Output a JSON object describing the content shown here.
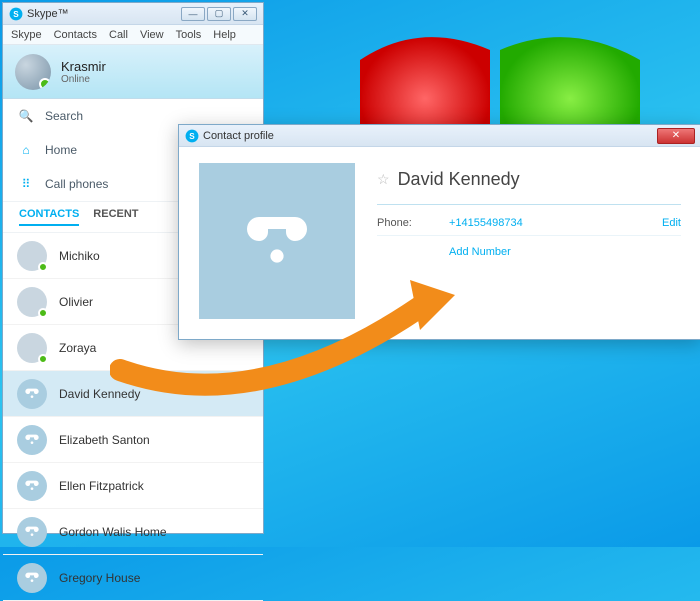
{
  "window": {
    "title": "Skype™",
    "menu": {
      "skype": "Skype",
      "contacts": "Contacts",
      "call": "Call",
      "view": "View",
      "tools": "Tools",
      "help": "Help"
    }
  },
  "user": {
    "name": "Krasmir",
    "status": "Online"
  },
  "nav": {
    "search": "Search",
    "home": "Home",
    "callphones": "Call phones"
  },
  "tabs": {
    "contacts": "CONTACTS",
    "recent": "RECENT"
  },
  "contacts": [
    {
      "name": "Michiko",
      "type": "person",
      "online": true
    },
    {
      "name": "Olivier",
      "type": "person",
      "online": true
    },
    {
      "name": "Zoraya",
      "type": "person",
      "online": true
    },
    {
      "name": "David Kennedy",
      "type": "phone",
      "online": false
    },
    {
      "name": "Elizabeth Santon",
      "type": "phone",
      "online": false
    },
    {
      "name": "Ellen Fitzpatrick",
      "type": "phone",
      "online": false
    },
    {
      "name": "Gordon Walis Home",
      "type": "phone",
      "online": false
    },
    {
      "name": "Gregory House",
      "type": "phone",
      "online": false
    }
  ],
  "profile": {
    "window_title": "Contact profile",
    "name": "David Kennedy",
    "phone_label": "Phone:",
    "phone_value": "+14155498734",
    "edit": "Edit",
    "add_number": "Add Number"
  }
}
